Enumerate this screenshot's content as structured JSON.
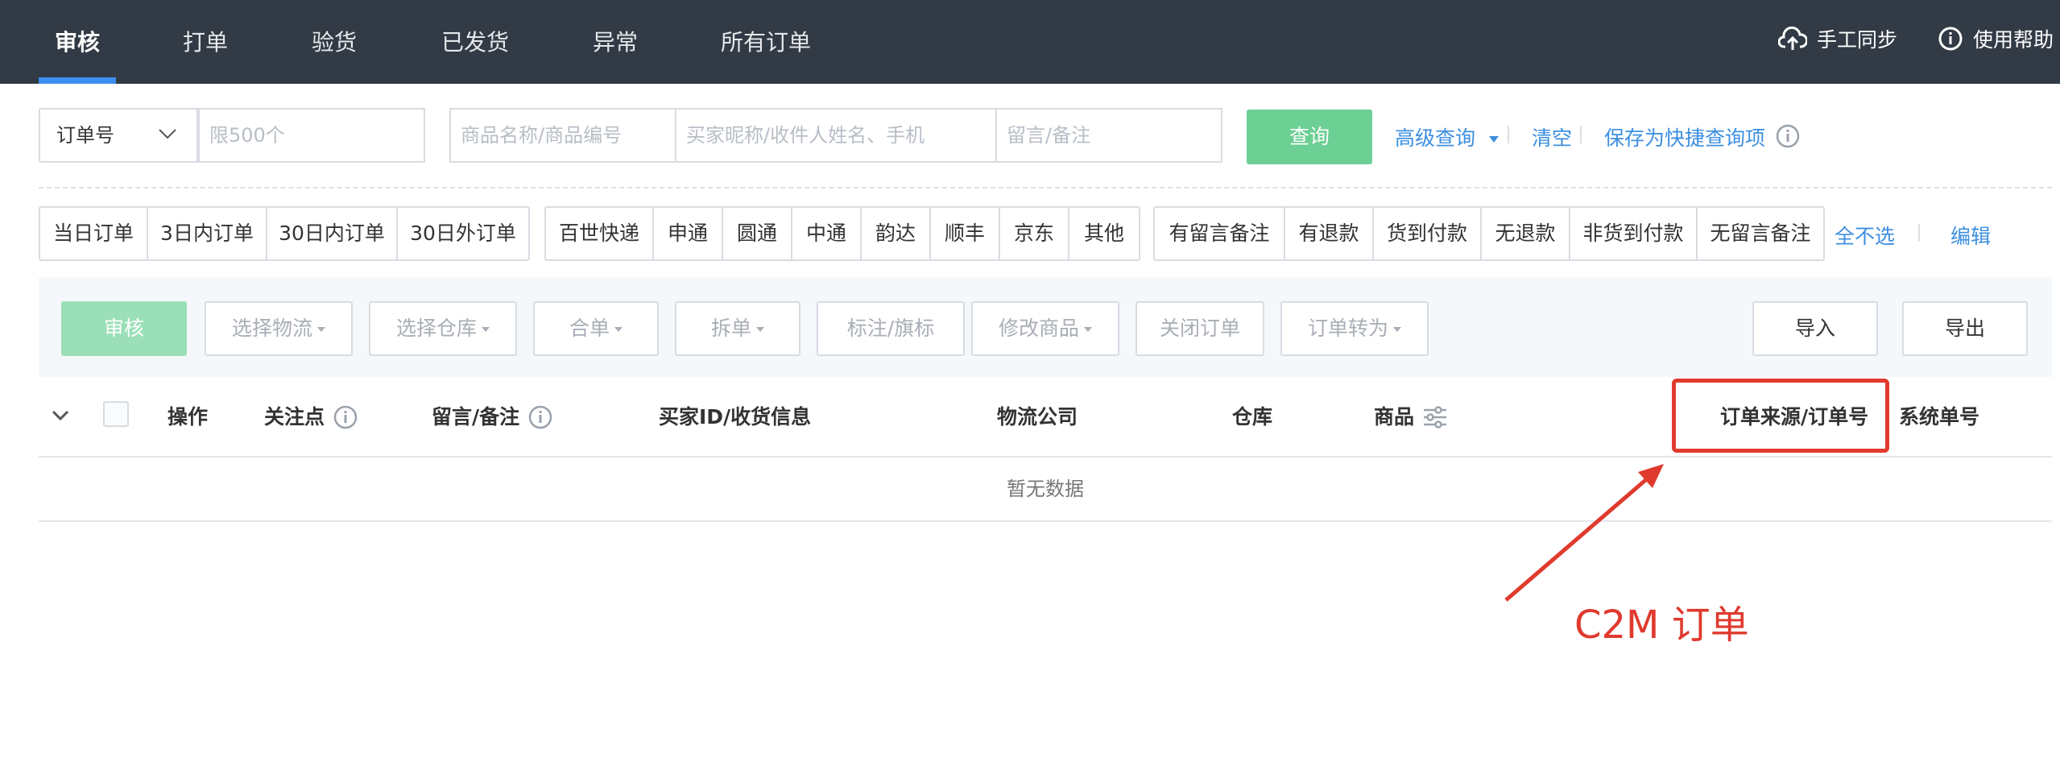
{
  "nav": {
    "tabs": [
      {
        "label": "审核"
      },
      {
        "label": "打单"
      },
      {
        "label": "验货"
      },
      {
        "label": "已发货"
      },
      {
        "label": "异常"
      },
      {
        "label": "所有订单"
      }
    ],
    "sync_label": "手工同步",
    "help_label": "使用帮助"
  },
  "search": {
    "select_value": "订单号",
    "limit_placeholder": "限500个",
    "product_placeholder": "商品名称/商品编号",
    "buyer_placeholder": "买家昵称/收件人姓名、手机",
    "note_placeholder": "留言/备注",
    "query_label": "查询",
    "advanced_label": "高级查询",
    "clear_label": "清空",
    "save_label": "保存为快捷查询项"
  },
  "filters": {
    "time": [
      "当日订单",
      "3日内订单",
      "30日内订单",
      "30日外订单"
    ],
    "logistics": [
      "百世快递",
      "申通",
      "圆通",
      "中通",
      "韵达",
      "顺丰",
      "京东",
      "其他"
    ],
    "status": [
      "有留言备注",
      "有退款",
      "货到付款",
      "无退款",
      "非货到付款",
      "无留言备注"
    ],
    "deselect_label": "全不选",
    "edit_label": "编辑"
  },
  "actions": {
    "audit": "审核",
    "select_logistics": "选择物流",
    "select_warehouse": "选择仓库",
    "merge": "合单",
    "split": "拆单",
    "mark": "标注/旗标",
    "modify_goods": "修改商品",
    "close_order": "关闭订单",
    "convert_order": "订单转为",
    "import": "导入",
    "export": "导出"
  },
  "table": {
    "headers": {
      "operation": "操作",
      "focus": "关注点",
      "note": "留言/备注",
      "buyer": "买家ID/收货信息",
      "logistics": "物流公司",
      "warehouse": "仓库",
      "goods": "商品",
      "source": "订单来源/订单号",
      "system_no": "系统单号"
    },
    "empty_text": "暂无数据"
  },
  "annotation": {
    "text": "C2M 订单",
    "color": "#e03a2e"
  },
  "colors": {
    "nav_bg": "#323a45",
    "accent": "#3d8ef0",
    "green": "#6ccf94",
    "link": "#3c8fe0"
  }
}
